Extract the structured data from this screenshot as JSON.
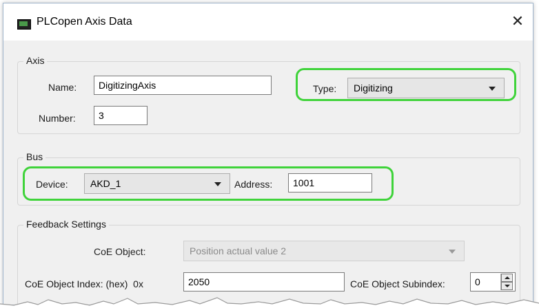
{
  "window": {
    "title": "PLCopen Axis Data",
    "close_symbol": "✕"
  },
  "axis": {
    "legend": "Axis",
    "name_label": "Name:",
    "name_value": "DigitizingAxis",
    "type_label": "Type:",
    "type_value": "Digitizing",
    "number_label": "Number:",
    "number_value": "3"
  },
  "bus": {
    "legend": "Bus",
    "device_label": "Device:",
    "device_value": "AKD_1",
    "address_label": "Address:",
    "address_value": "1001"
  },
  "feedback": {
    "legend": "Feedback Settings",
    "coe_object_label": "CoE Object:",
    "coe_object_value": "Position actual value 2",
    "coe_index_label": "CoE Object Index: (hex)  0x",
    "coe_index_value": "2050",
    "coe_subindex_label": "CoE Object Subindex:",
    "coe_subindex_value": "0"
  },
  "colors": {
    "highlight": "#3fd33a",
    "dialog_bg": "#f0f0f0"
  },
  "icons": {
    "app": "monitor-icon",
    "close": "close-icon",
    "dropdown": "chevron-down-icon",
    "spin_up": "spin-up-icon",
    "spin_down": "spin-down-icon"
  }
}
